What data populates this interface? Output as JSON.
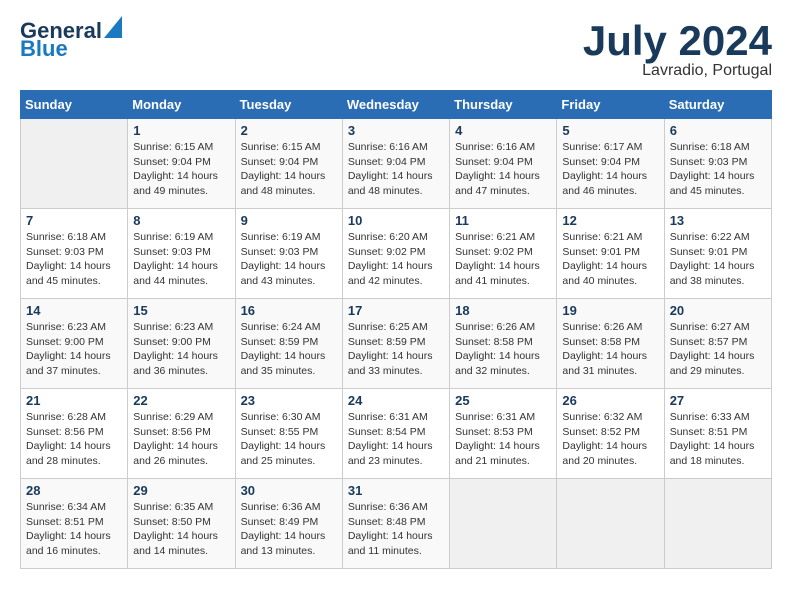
{
  "header": {
    "logo_line1": "General",
    "logo_line2": "Blue",
    "month": "July 2024",
    "location": "Lavradio, Portugal"
  },
  "weekdays": [
    "Sunday",
    "Monday",
    "Tuesday",
    "Wednesday",
    "Thursday",
    "Friday",
    "Saturday"
  ],
  "weeks": [
    [
      {
        "day": "",
        "info": ""
      },
      {
        "day": "1",
        "info": "Sunrise: 6:15 AM\nSunset: 9:04 PM\nDaylight: 14 hours\nand 49 minutes."
      },
      {
        "day": "2",
        "info": "Sunrise: 6:15 AM\nSunset: 9:04 PM\nDaylight: 14 hours\nand 48 minutes."
      },
      {
        "day": "3",
        "info": "Sunrise: 6:16 AM\nSunset: 9:04 PM\nDaylight: 14 hours\nand 48 minutes."
      },
      {
        "day": "4",
        "info": "Sunrise: 6:16 AM\nSunset: 9:04 PM\nDaylight: 14 hours\nand 47 minutes."
      },
      {
        "day": "5",
        "info": "Sunrise: 6:17 AM\nSunset: 9:04 PM\nDaylight: 14 hours\nand 46 minutes."
      },
      {
        "day": "6",
        "info": "Sunrise: 6:18 AM\nSunset: 9:03 PM\nDaylight: 14 hours\nand 45 minutes."
      }
    ],
    [
      {
        "day": "7",
        "info": "Sunrise: 6:18 AM\nSunset: 9:03 PM\nDaylight: 14 hours\nand 45 minutes."
      },
      {
        "day": "8",
        "info": "Sunrise: 6:19 AM\nSunset: 9:03 PM\nDaylight: 14 hours\nand 44 minutes."
      },
      {
        "day": "9",
        "info": "Sunrise: 6:19 AM\nSunset: 9:03 PM\nDaylight: 14 hours\nand 43 minutes."
      },
      {
        "day": "10",
        "info": "Sunrise: 6:20 AM\nSunset: 9:02 PM\nDaylight: 14 hours\nand 42 minutes."
      },
      {
        "day": "11",
        "info": "Sunrise: 6:21 AM\nSunset: 9:02 PM\nDaylight: 14 hours\nand 41 minutes."
      },
      {
        "day": "12",
        "info": "Sunrise: 6:21 AM\nSunset: 9:01 PM\nDaylight: 14 hours\nand 40 minutes."
      },
      {
        "day": "13",
        "info": "Sunrise: 6:22 AM\nSunset: 9:01 PM\nDaylight: 14 hours\nand 38 minutes."
      }
    ],
    [
      {
        "day": "14",
        "info": "Sunrise: 6:23 AM\nSunset: 9:00 PM\nDaylight: 14 hours\nand 37 minutes."
      },
      {
        "day": "15",
        "info": "Sunrise: 6:23 AM\nSunset: 9:00 PM\nDaylight: 14 hours\nand 36 minutes."
      },
      {
        "day": "16",
        "info": "Sunrise: 6:24 AM\nSunset: 8:59 PM\nDaylight: 14 hours\nand 35 minutes."
      },
      {
        "day": "17",
        "info": "Sunrise: 6:25 AM\nSunset: 8:59 PM\nDaylight: 14 hours\nand 33 minutes."
      },
      {
        "day": "18",
        "info": "Sunrise: 6:26 AM\nSunset: 8:58 PM\nDaylight: 14 hours\nand 32 minutes."
      },
      {
        "day": "19",
        "info": "Sunrise: 6:26 AM\nSunset: 8:58 PM\nDaylight: 14 hours\nand 31 minutes."
      },
      {
        "day": "20",
        "info": "Sunrise: 6:27 AM\nSunset: 8:57 PM\nDaylight: 14 hours\nand 29 minutes."
      }
    ],
    [
      {
        "day": "21",
        "info": "Sunrise: 6:28 AM\nSunset: 8:56 PM\nDaylight: 14 hours\nand 28 minutes."
      },
      {
        "day": "22",
        "info": "Sunrise: 6:29 AM\nSunset: 8:56 PM\nDaylight: 14 hours\nand 26 minutes."
      },
      {
        "day": "23",
        "info": "Sunrise: 6:30 AM\nSunset: 8:55 PM\nDaylight: 14 hours\nand 25 minutes."
      },
      {
        "day": "24",
        "info": "Sunrise: 6:31 AM\nSunset: 8:54 PM\nDaylight: 14 hours\nand 23 minutes."
      },
      {
        "day": "25",
        "info": "Sunrise: 6:31 AM\nSunset: 8:53 PM\nDaylight: 14 hours\nand 21 minutes."
      },
      {
        "day": "26",
        "info": "Sunrise: 6:32 AM\nSunset: 8:52 PM\nDaylight: 14 hours\nand 20 minutes."
      },
      {
        "day": "27",
        "info": "Sunrise: 6:33 AM\nSunset: 8:51 PM\nDaylight: 14 hours\nand 18 minutes."
      }
    ],
    [
      {
        "day": "28",
        "info": "Sunrise: 6:34 AM\nSunset: 8:51 PM\nDaylight: 14 hours\nand 16 minutes."
      },
      {
        "day": "29",
        "info": "Sunrise: 6:35 AM\nSunset: 8:50 PM\nDaylight: 14 hours\nand 14 minutes."
      },
      {
        "day": "30",
        "info": "Sunrise: 6:36 AM\nSunset: 8:49 PM\nDaylight: 14 hours\nand 13 minutes."
      },
      {
        "day": "31",
        "info": "Sunrise: 6:36 AM\nSunset: 8:48 PM\nDaylight: 14 hours\nand 11 minutes."
      },
      {
        "day": "",
        "info": ""
      },
      {
        "day": "",
        "info": ""
      },
      {
        "day": "",
        "info": ""
      }
    ]
  ]
}
